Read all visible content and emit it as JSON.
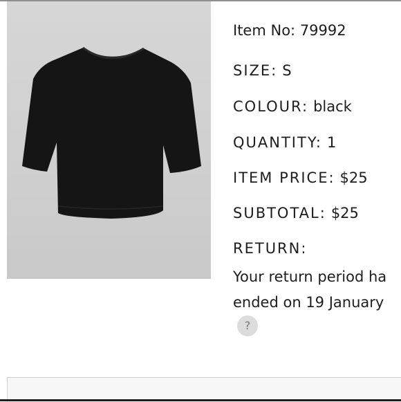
{
  "product": {
    "image_alt": "black t-shirt",
    "item_no_label": "Item No:",
    "item_no": "79992"
  },
  "details": {
    "size_label": "SIZE:",
    "size": "S",
    "colour_label": "COLOUR:",
    "colour": "black",
    "quantity_label": "QUANTITY:",
    "quantity": "1",
    "item_price_label": "ITEM PRICE:",
    "item_price": "$25",
    "subtotal_label": "SUBTOTAL:",
    "subtotal": "$25",
    "return_label": "RETURN:",
    "return_line1": "Your return period ha",
    "return_line2": "ended on 19 January",
    "help_symbol": "?"
  },
  "colors": {
    "garment": "#151515",
    "image_bg": "#d2d2d2",
    "text": "#1d1d1d"
  }
}
